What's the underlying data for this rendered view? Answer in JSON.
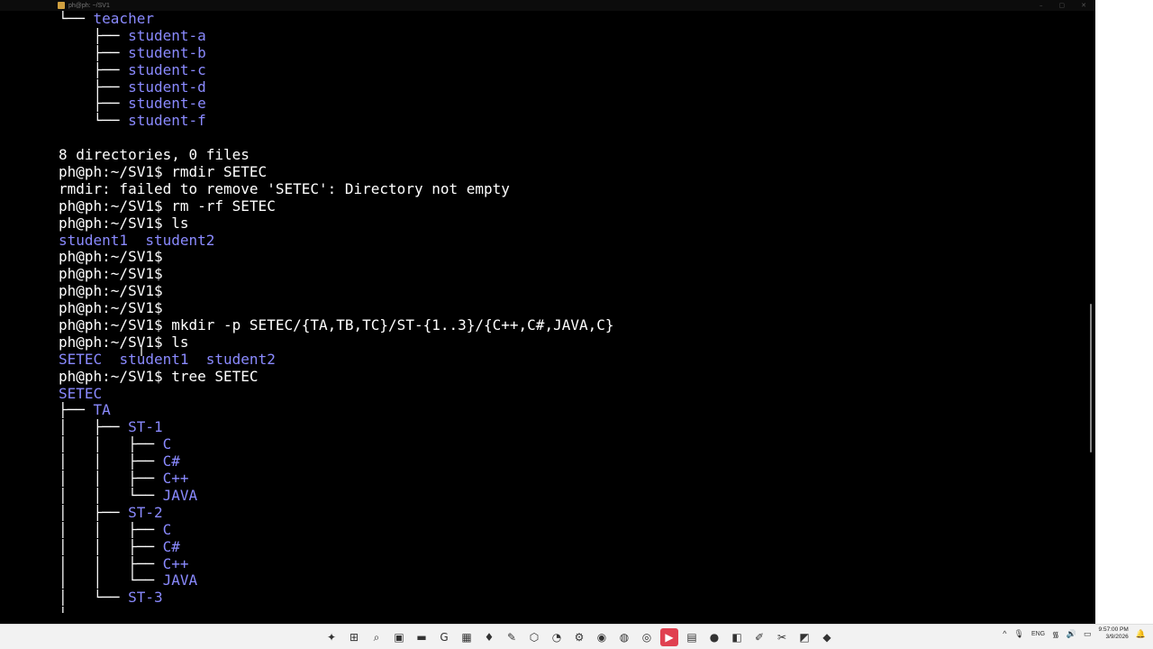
{
  "window": {
    "title": "ph@ph: ~/SV1",
    "controls": [
      "–",
      "▢",
      "✕"
    ]
  },
  "terminal": {
    "lines": [
      [
        {
          "t": "└── ",
          "c": "std"
        },
        {
          "t": "teacher",
          "c": "dir"
        }
      ],
      [
        {
          "t": "    ├── ",
          "c": "std"
        },
        {
          "t": "student-a",
          "c": "dir"
        }
      ],
      [
        {
          "t": "    ├── ",
          "c": "std"
        },
        {
          "t": "student-b",
          "c": "dir"
        }
      ],
      [
        {
          "t": "    ├── ",
          "c": "std"
        },
        {
          "t": "student-c",
          "c": "dir"
        }
      ],
      [
        {
          "t": "    ├── ",
          "c": "std"
        },
        {
          "t": "student-d",
          "c": "dir"
        }
      ],
      [
        {
          "t": "    ├── ",
          "c": "std"
        },
        {
          "t": "student-e",
          "c": "dir"
        }
      ],
      [
        {
          "t": "    └── ",
          "c": "std"
        },
        {
          "t": "student-f",
          "c": "dir"
        }
      ],
      [
        {
          "t": "",
          "c": "std"
        }
      ],
      [
        {
          "t": "8 directories, 0 files",
          "c": "std"
        }
      ],
      [
        {
          "t": "ph@ph:~/SV1$ rmdir SETEC",
          "c": "std"
        }
      ],
      [
        {
          "t": "rmdir: failed to remove 'SETEC': Directory not empty",
          "c": "std"
        }
      ],
      [
        {
          "t": "ph@ph:~/SV1$ rm -rf SETEC",
          "c": "std"
        }
      ],
      [
        {
          "t": "ph@ph:~/SV1$ ls",
          "c": "std"
        }
      ],
      [
        {
          "t": "student1",
          "c": "dir"
        },
        {
          "t": "  ",
          "c": "std"
        },
        {
          "t": "student2",
          "c": "dir"
        }
      ],
      [
        {
          "t": "ph@ph:~/SV1$",
          "c": "std"
        }
      ],
      [
        {
          "t": "ph@ph:~/SV1$",
          "c": "std"
        }
      ],
      [
        {
          "t": "ph@ph:~/SV1$",
          "c": "std"
        }
      ],
      [
        {
          "t": "ph@ph:~/SV1$",
          "c": "std"
        }
      ],
      [
        {
          "t": "ph@ph:~/SV1$ mkdir -p SETEC/{TA,TB,TC}/ST-{1..3}/{C++,C#,JAVA,C}",
          "c": "std"
        }
      ],
      [
        {
          "t": "ph@ph:~/SV1$ ls",
          "c": "std"
        }
      ],
      [
        {
          "t": "SETEC",
          "c": "dir"
        },
        {
          "t": "  ",
          "c": "std"
        },
        {
          "t": "student1",
          "c": "dir"
        },
        {
          "t": "  ",
          "c": "std"
        },
        {
          "t": "student2",
          "c": "dir"
        }
      ],
      [
        {
          "t": "ph@ph:~/SV1$ tree SETEC",
          "c": "std"
        }
      ],
      [
        {
          "t": "SETEC",
          "c": "dir"
        }
      ],
      [
        {
          "t": "├── ",
          "c": "std"
        },
        {
          "t": "TA",
          "c": "dir"
        }
      ],
      [
        {
          "t": "│   ├── ",
          "c": "std"
        },
        {
          "t": "ST-1",
          "c": "dir"
        }
      ],
      [
        {
          "t": "│   │   ├── ",
          "c": "std"
        },
        {
          "t": "C",
          "c": "dir"
        }
      ],
      [
        {
          "t": "│   │   ├── ",
          "c": "std"
        },
        {
          "t": "C#",
          "c": "dir"
        }
      ],
      [
        {
          "t": "│   │   ├── ",
          "c": "std"
        },
        {
          "t": "C++",
          "c": "dir"
        }
      ],
      [
        {
          "t": "│   │   └── ",
          "c": "std"
        },
        {
          "t": "JAVA",
          "c": "dir"
        }
      ],
      [
        {
          "t": "│   ├── ",
          "c": "std"
        },
        {
          "t": "ST-2",
          "c": "dir"
        }
      ],
      [
        {
          "t": "│   │   ├── ",
          "c": "std"
        },
        {
          "t": "C",
          "c": "dir"
        }
      ],
      [
        {
          "t": "│   │   ├── ",
          "c": "std"
        },
        {
          "t": "C#",
          "c": "dir"
        }
      ],
      [
        {
          "t": "│   │   ├── ",
          "c": "std"
        },
        {
          "t": "C++",
          "c": "dir"
        }
      ],
      [
        {
          "t": "│   │   └── ",
          "c": "std"
        },
        {
          "t": "JAVA",
          "c": "dir"
        }
      ],
      [
        {
          "t": "│   └── ",
          "c": "std"
        },
        {
          "t": "ST-3",
          "c": "dir"
        }
      ],
      [
        {
          "t": "│",
          "c": "std"
        }
      ]
    ]
  },
  "colors": {
    "background": "#000000",
    "directory": "#8a8aff",
    "text": "#ffffff",
    "active_app": "#e04050"
  },
  "taskbar": {
    "apps": [
      {
        "name": "copilot-icon",
        "glyph": "✦"
      },
      {
        "name": "windows-start-icon",
        "glyph": "⊞"
      },
      {
        "name": "search-icon",
        "glyph": "⌕"
      },
      {
        "name": "task-view-icon",
        "glyph": "▣"
      },
      {
        "name": "file-explorer-icon",
        "glyph": "▬"
      },
      {
        "name": "grammarly-icon",
        "glyph": "G"
      },
      {
        "name": "store-icon",
        "glyph": "▦"
      },
      {
        "name": "drop-icon",
        "glyph": "♦"
      },
      {
        "name": "pen-app-icon",
        "glyph": "✎"
      },
      {
        "name": "hex-app-icon",
        "glyph": "⬡"
      },
      {
        "name": "edge-icon",
        "glyph": "◔"
      },
      {
        "name": "settings-icon",
        "glyph": "⚙"
      },
      {
        "name": "chrome-icon",
        "glyph": "◉"
      },
      {
        "name": "chrome-alt-icon",
        "glyph": "◍"
      },
      {
        "name": "chrome-beta-icon",
        "glyph": "◎"
      },
      {
        "name": "terminal-app-icon",
        "glyph": "▶",
        "active": true
      },
      {
        "name": "notepad-icon",
        "glyph": "▤"
      },
      {
        "name": "red-app-icon",
        "glyph": "●"
      },
      {
        "name": "vscode-icon",
        "glyph": "◧"
      },
      {
        "name": "paint-icon",
        "glyph": "✐"
      },
      {
        "name": "snip-icon",
        "glyph": "✂"
      },
      {
        "name": "remote-icon",
        "glyph": "◩"
      },
      {
        "name": "git-icon",
        "glyph": "◆"
      }
    ],
    "tray": {
      "chevron": "^",
      "mic": "🎙",
      "language": "ENG",
      "wifi": "᯾",
      "volume": "🔊",
      "battery": "▭",
      "time": "9:57:00 PM",
      "date": "3/9/2026",
      "notification": "🔔"
    }
  }
}
